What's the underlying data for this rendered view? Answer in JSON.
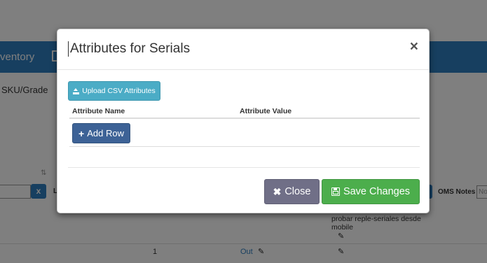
{
  "background": {
    "nav_label": "ventory",
    "sku_label": "SKU/Grade",
    "sort_glyph": "⇅",
    "filter_clear": "x",
    "column_l": "L",
    "oms_notes_label": "OMS Notes",
    "oms_notes_placeholder": "No",
    "row_note": "probar reple-seriales desde mobile",
    "row_qty": "1",
    "row_status": "Out",
    "pencil_glyph": "✎"
  },
  "modal": {
    "title": "Attributes for Serials",
    "close_glyph": "×",
    "upload_label": "Upload CSV Attributes",
    "table": {
      "columns": [
        "Attribute Name",
        "Attribute Value"
      ],
      "add_row_label": "Add Row",
      "add_row_glyph": "+"
    },
    "footer": {
      "close_label": "Close",
      "close_glyph": "✖",
      "save_label": "Save Changes"
    }
  },
  "colors": {
    "nav_blue": "#2f7fc1",
    "upload_teal": "#4bacc6",
    "add_row_navy": "#3d6296",
    "close_gray": "#706f87",
    "save_green": "#4cae4c"
  }
}
